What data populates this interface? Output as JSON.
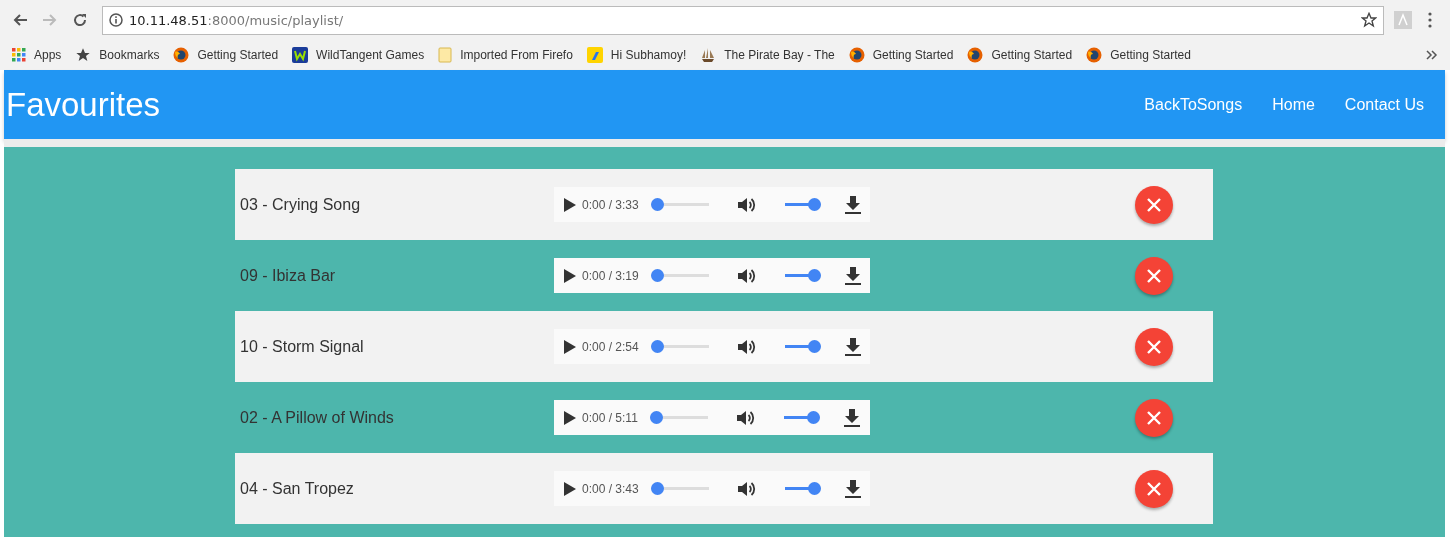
{
  "browser": {
    "url_host": "10.11.48.51",
    "url_rest": ":8000/music/playlist/",
    "bookmarks": [
      {
        "kind": "apps",
        "label": "Apps"
      },
      {
        "kind": "star",
        "label": "Bookmarks"
      },
      {
        "kind": "firefox",
        "label": "Getting Started"
      },
      {
        "kind": "wild",
        "label": "WildTangent Games"
      },
      {
        "kind": "folder",
        "label": "Imported From Firefo"
      },
      {
        "kind": "flipkart",
        "label": "Hi Subhamoy!"
      },
      {
        "kind": "ship",
        "label": "The Pirate Bay - The"
      },
      {
        "kind": "firefox",
        "label": "Getting Started"
      },
      {
        "kind": "firefox",
        "label": "Getting Started"
      },
      {
        "kind": "firefox",
        "label": "Getting Started"
      }
    ]
  },
  "header": {
    "title": "Favourites",
    "nav": [
      "BackToSongs",
      "Home",
      "Contact Us"
    ]
  },
  "songs": [
    {
      "title": "03 - Crying Song",
      "time": "0:00 / 3:33",
      "progress": {
        "level": 0.0
      },
      "volume": {
        "level": 1.0
      }
    },
    {
      "title": "09 - Ibiza Bar",
      "time": "0:00 / 3:19",
      "progress": {
        "level": 0.0
      },
      "volume": {
        "level": 1.0
      }
    },
    {
      "title": "10 - Storm Signal",
      "time": "0:00 / 2:54",
      "progress": {
        "level": 0.0
      },
      "volume": {
        "level": 1.0
      }
    },
    {
      "title": "02 - A Pillow of Winds",
      "time": "0:00 / 5:11",
      "progress": {
        "level": 0.0
      },
      "volume": {
        "level": 1.0
      }
    },
    {
      "title": "04 - San Tropez",
      "time": "0:00 / 3:43",
      "progress": {
        "level": 0.0
      },
      "volume": {
        "level": 1.0
      }
    }
  ]
}
